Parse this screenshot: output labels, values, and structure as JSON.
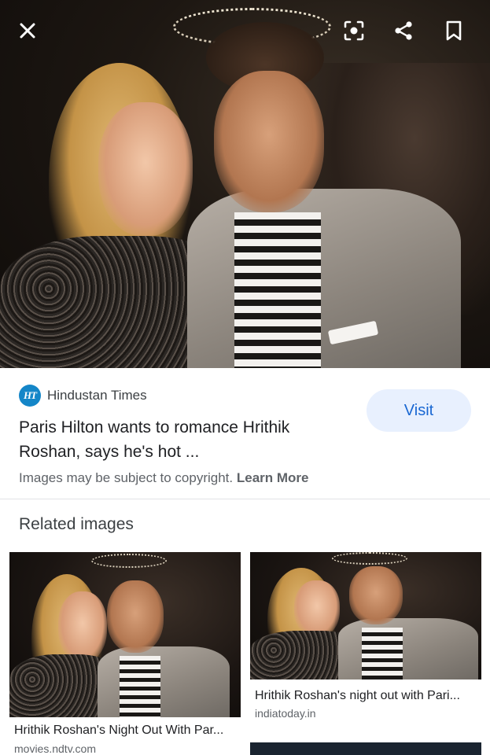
{
  "toolbar": {
    "close_icon": "close-icon",
    "lens_icon": "lens-icon",
    "share_icon": "share-icon",
    "bookmark_icon": "bookmark-icon"
  },
  "result": {
    "source_logo_text": "HT",
    "source_name": "Hindustan Times",
    "title": "Paris Hilton wants to romance Hrithik Roshan, says he's hot ...",
    "visit_label": "Visit",
    "copyright_text": "Images may be subject to copyright.",
    "learn_more": "Learn More"
  },
  "related": {
    "heading": "Related images",
    "items": [
      {
        "title": "Hrithik Roshan's Night Out With Par...",
        "domain": "movies.ndtv.com"
      },
      {
        "title": "Hrithik Roshan's night out with Pari...",
        "domain": "indiatoday.in"
      }
    ]
  },
  "colors": {
    "accent": "#1967d2",
    "visit_bg": "#e8f0fe",
    "logo_bg": "#1486c8"
  }
}
